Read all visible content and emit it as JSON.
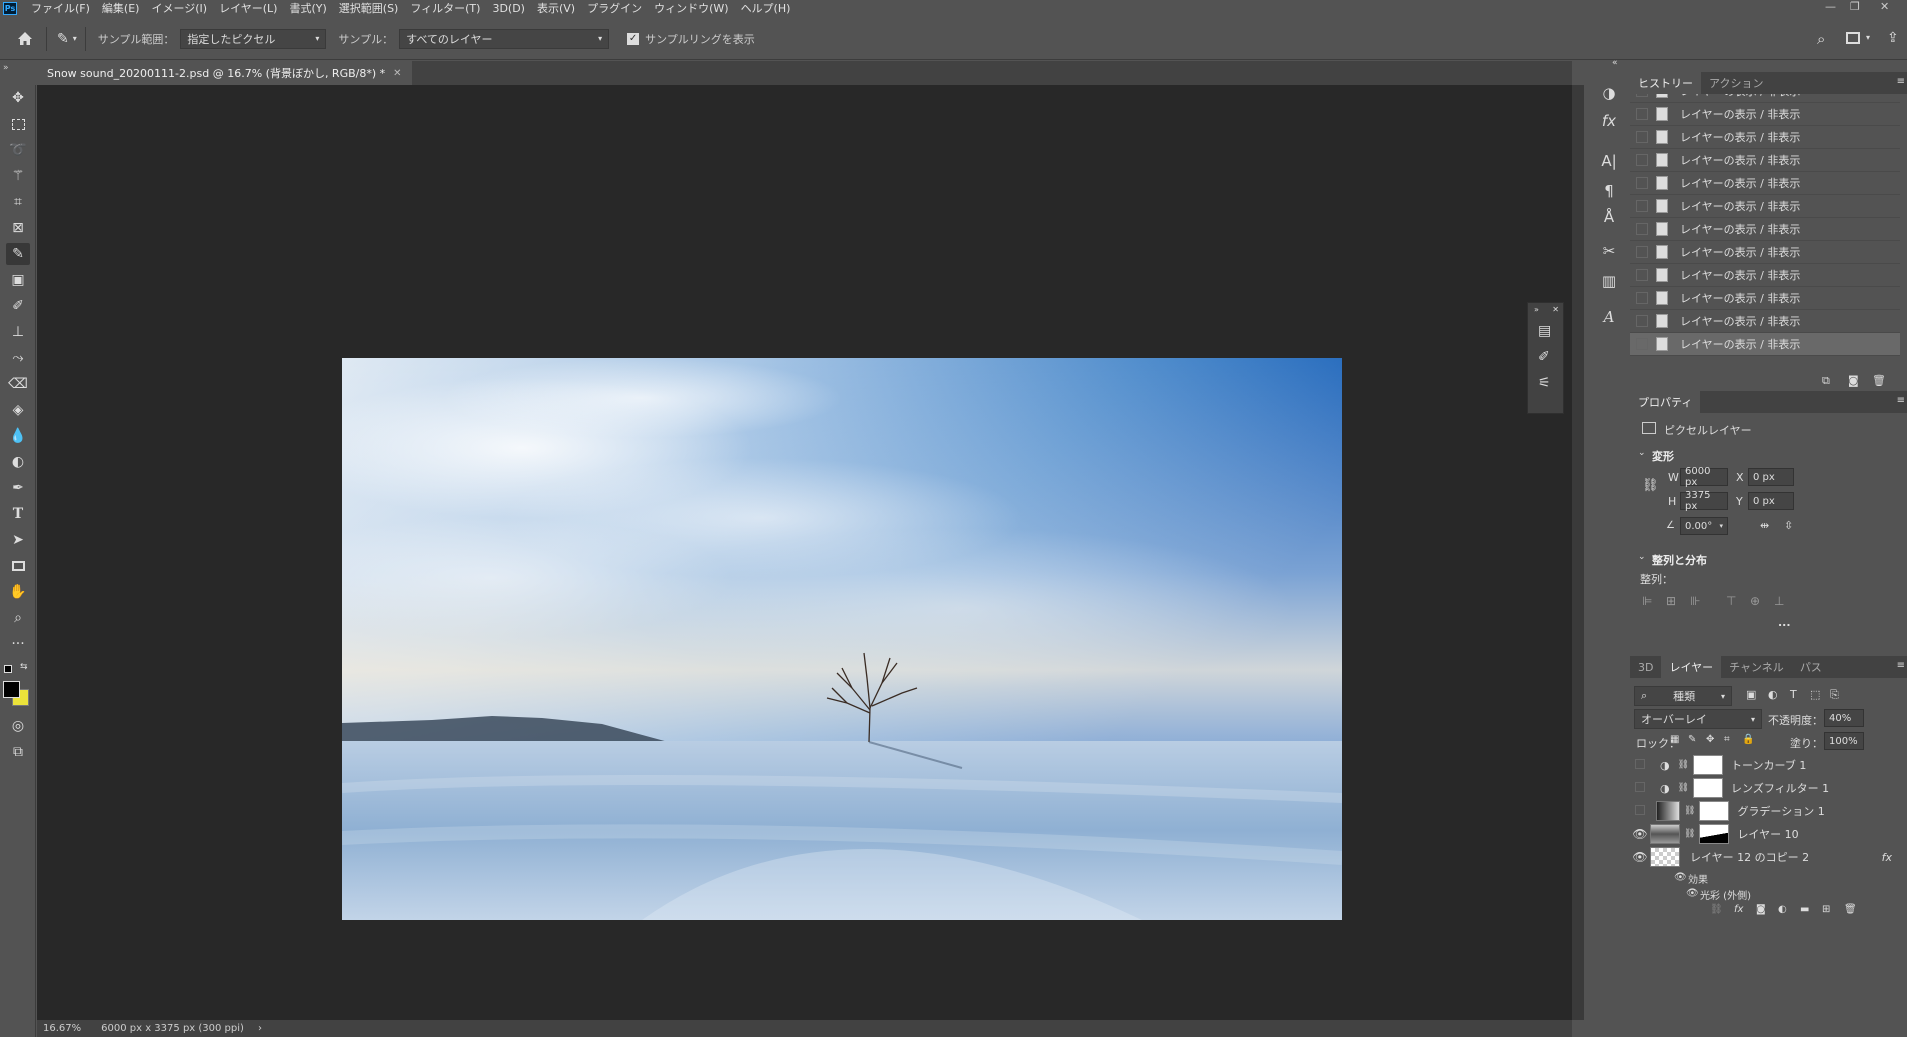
{
  "app": {
    "logo": "Ps"
  },
  "menubar": {
    "items": [
      "ファイル(F)",
      "編集(E)",
      "イメージ(I)",
      "レイヤー(L)",
      "書式(Y)",
      "選択範囲(S)",
      "フィルター(T)",
      "3D(D)",
      "表示(V)",
      "プラグイン",
      "ウィンドウ(W)",
      "ヘルプ(H)"
    ]
  },
  "optionsbar": {
    "sample_size_label": "サンプル範囲：",
    "sample_size_value": "指定したピクセル",
    "sample_label": "サンプル：",
    "sample_value": "すべてのレイヤー",
    "show_ring_label": "サンプルリングを表示",
    "show_ring_checked": true
  },
  "document": {
    "tab_title": "Snow sound_20200111-2.psd @ 16.7% (背景ぼかし, RGB/8*) *"
  },
  "status": {
    "zoom": "16.67%",
    "dimensions": "6000 px x 3375 px (300 ppi)",
    "arrow": "›"
  },
  "history": {
    "tabs": [
      "ヒストリー",
      "アクション"
    ],
    "items": [
      "レイヤーの表示 / 非表示",
      "レイヤーの表示 / 非表示",
      "レイヤーの表示 / 非表示",
      "レイヤーの表示 / 非表示",
      "レイヤーの表示 / 非表示",
      "レイヤーの表示 / 非表示",
      "レイヤーの表示 / 非表示",
      "レイヤーの表示 / 非表示",
      "レイヤーの表示 / 非表示",
      "レイヤーの表示 / 非表示",
      "レイヤーの表示 / 非表示"
    ]
  },
  "properties": {
    "tab": "プロパティ",
    "type": "ピクセルレイヤー",
    "transform_title": "変形",
    "w_label": "W",
    "w": "6000 px",
    "h_label": "H",
    "h": "3375 px",
    "x_label": "X",
    "x": "0 px",
    "y_label": "Y",
    "y": "0 px",
    "angle": "0.00°",
    "align_title": "整列と分布",
    "align_label": "整列：",
    "more": "..."
  },
  "layers": {
    "tabs": [
      "3D",
      "レイヤー",
      "チャンネル",
      "パス"
    ],
    "filter": "種類",
    "blend_mode": "オーバーレイ",
    "opacity_label": "不透明度：",
    "opacity": "40%",
    "lock_label": "ロック：",
    "fill_label": "塗り：",
    "fill": "100%",
    "items": [
      {
        "name": "トーンカーブ 1",
        "visible": false
      },
      {
        "name": "レンズフィルター 1",
        "visible": false
      },
      {
        "name": "グラデーション 1",
        "visible": false
      },
      {
        "name": "レイヤー 10",
        "visible": true
      },
      {
        "name": "レイヤー 12 のコピー 2",
        "visible": true,
        "fx": "fx"
      }
    ],
    "effects_label": "効果",
    "effect_item": "光彩 (外側)"
  }
}
